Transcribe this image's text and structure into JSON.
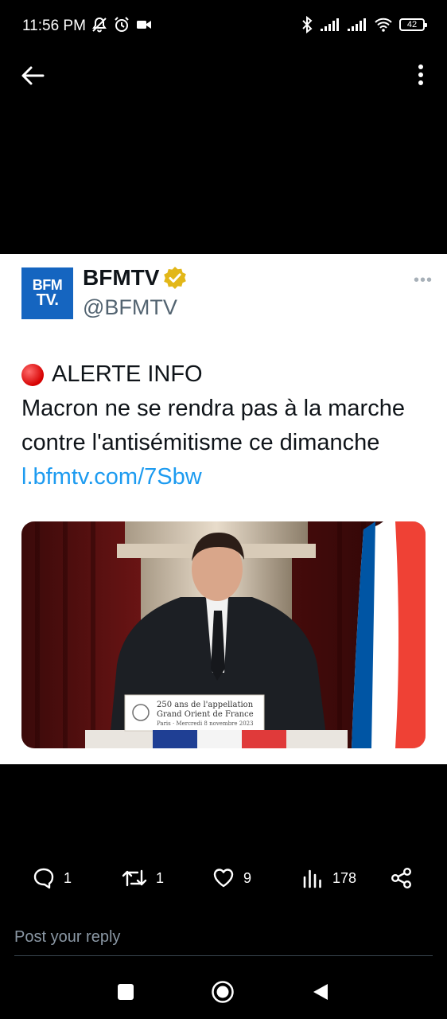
{
  "status": {
    "time": "11:56 PM",
    "battery": "42"
  },
  "tweet": {
    "display_name": "BFMTV",
    "handle": "@BFMTV",
    "avatar_line1": "BFM",
    "avatar_line2": "TV.",
    "alert": "ALERTE INFO",
    "body": "Macron ne se rendra pas à la marche contre l'antisémitisme ce dimanche",
    "link": "l.bfmtv.com/7Sbw",
    "podium_sign": [
      "250 ans de l'appellation",
      "Grand Orient de France",
      "Paris · Mercredi 8 novembre 2023"
    ]
  },
  "actions": {
    "replies": "1",
    "reposts": "1",
    "likes": "9",
    "views": "178"
  },
  "reply": {
    "placeholder": "Post your reply"
  },
  "colors": {
    "link": "#1d9bf0",
    "verified_badge": "#e2b719",
    "avatar_bg": "#1565c0"
  }
}
